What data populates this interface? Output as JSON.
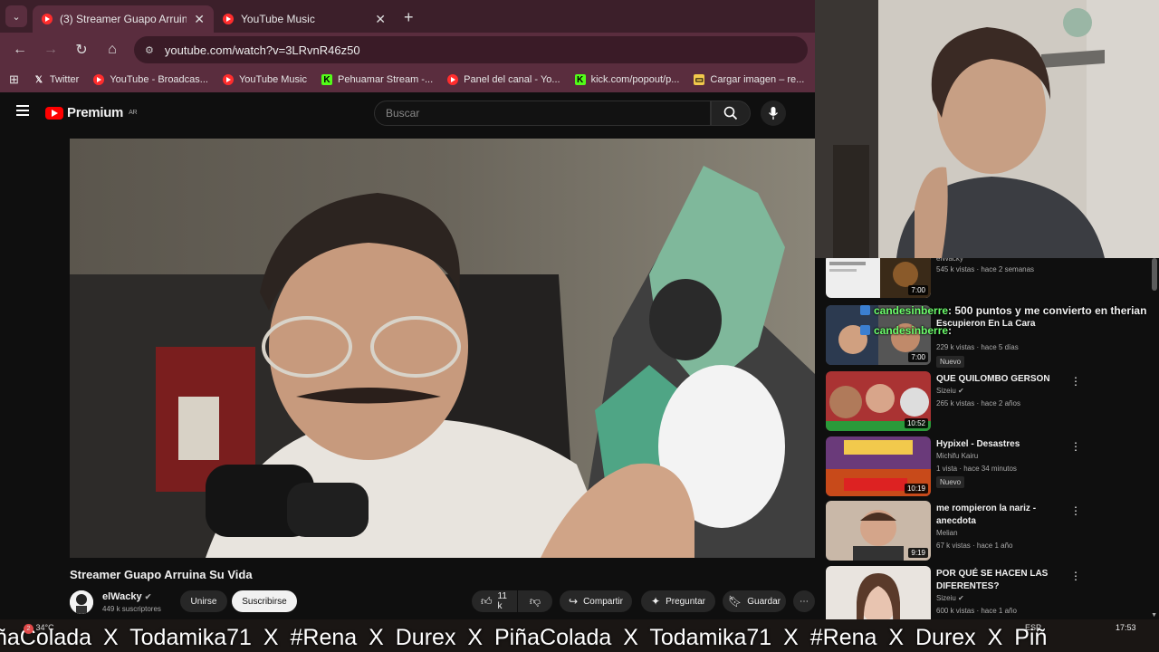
{
  "browser": {
    "tabs": [
      {
        "title": "(3) Streamer Guapo Arruina Su",
        "active": true
      },
      {
        "title": "YouTube Music",
        "active": false
      }
    ],
    "new_tab": "+",
    "url": "youtube.com/watch?v=3LRvnR46z50",
    "bookmarks": [
      {
        "label": "Twitter",
        "icon": "x-logo-icon"
      },
      {
        "label": "YouTube - Broadcas...",
        "icon": "youtube-icon"
      },
      {
        "label": "YouTube Music",
        "icon": "youtube-music-icon"
      },
      {
        "label": "Pehuamar Stream -...",
        "icon": "kick-icon"
      },
      {
        "label": "Panel del canal - Yo...",
        "icon": "youtube-icon"
      },
      {
        "label": "kick.com/popout/p...",
        "icon": "kick-icon"
      },
      {
        "label": "Cargar imagen – re...",
        "icon": "image-icon"
      }
    ]
  },
  "youtube": {
    "logo_text": "Premium",
    "region": "AR",
    "search_placeholder": "Buscar",
    "video": {
      "title": "Streamer Guapo Arruina Su Vida",
      "channel": "elWacky",
      "subscribers": "449 k suscriptores",
      "join_label": "Unirse",
      "subscribe_label": "Suscribirse",
      "likes": "11 k",
      "share_label": "Compartir",
      "ask_label": "Preguntar",
      "save_label": "Guardar"
    },
    "recommendations": [
      {
        "title": "",
        "channel": "elWacky",
        "meta": "545 k vistas · hace 2 semanas",
        "duration": "7:00",
        "badge": ""
      },
      {
        "title": "Escupieron En La Cara",
        "channel": "",
        "meta": "229 k vistas · hace 5 días",
        "duration": "7:00",
        "badge": "Nuevo"
      },
      {
        "title": "QUE QUILOMBO GERSON",
        "channel": "Sizeiu",
        "meta": "265 k vistas · hace 2 años",
        "duration": "10:52",
        "badge": ""
      },
      {
        "title": "Hypixel - Desastres",
        "channel": "Michifu Kairu",
        "meta": "1 vista · hace 34 minutos",
        "duration": "10:19",
        "badge": "Nuevo"
      },
      {
        "title": "me rompieron la nariz - anecdota",
        "channel": "Melian",
        "meta": "67 k vistas · hace 1 año",
        "duration": "9:19",
        "badge": ""
      },
      {
        "title": "POR QUÉ SE HACEN LAS DIFERENTES?",
        "channel": "Sizeiu",
        "meta": "600 k vistas · hace 1 año",
        "duration": "",
        "badge": ""
      }
    ]
  },
  "stream_overlay": {
    "chat": [
      {
        "user": "candesinberre",
        "message": ": 500 puntos y me convierto en therian"
      },
      {
        "user": "candesinberre",
        "message": ":"
      }
    ],
    "ticker": "ñaColada  X  Todamika71  X    #Rena  X  Durex  X  PiñaColada  X  Todamika71  X    #Rena  X  Durex  X  Piñ"
  },
  "taskbar": {
    "temperature": "34°C",
    "language": "ESP",
    "time": "17:53",
    "notification_count": "2"
  },
  "colors": {
    "tab_bg": "#3c1f2a",
    "toolbar_bg": "#5a2d3e",
    "yt_red": "#ff0000",
    "chat_user": "#6dff6d"
  }
}
